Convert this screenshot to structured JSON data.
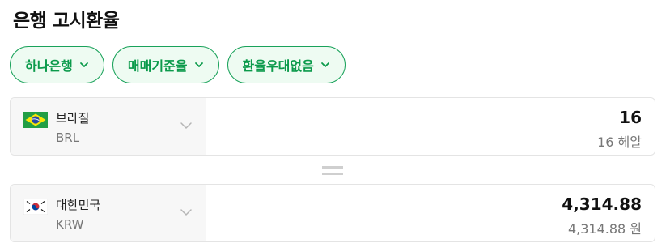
{
  "page": {
    "title": "은행 고시환율"
  },
  "chips": [
    {
      "label": "하나은행",
      "icon": "chevron-down-icon"
    },
    {
      "label": "매매기준율",
      "icon": "chevron-down-icon"
    },
    {
      "label": "환율우대없음",
      "icon": "chevron-down-icon"
    }
  ],
  "from": {
    "country": "브라질",
    "code": "BRL",
    "flag_icon": "brazil-flag-icon",
    "amount": "16",
    "unit_text": "16 헤알"
  },
  "to": {
    "country": "대한민국",
    "code": "KRW",
    "flag_icon": "south-korea-flag-icon",
    "amount": "4,314.88",
    "unit_text": "4,314.88 원"
  },
  "colors": {
    "accent": "#0b9a4b",
    "chip_border": "#19a25a",
    "chip_bg": "#eefbf2"
  }
}
